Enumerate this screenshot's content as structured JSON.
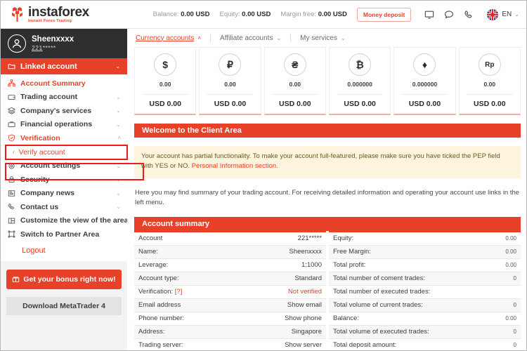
{
  "header": {
    "brand_name": "instaforex",
    "brand_tagline": "Instant Forex Trading",
    "stats": [
      {
        "label": "Balance:",
        "value": "0.00 USD"
      },
      {
        "label": "Equity:",
        "value": "0.00 USD"
      },
      {
        "label": "Margin free:",
        "value": "0.00 USD"
      }
    ],
    "deposit_button": "Money deposit",
    "icons": [
      "monitor-icon",
      "chat-icon",
      "phone-icon"
    ],
    "language": "EN",
    "language_caret": "⌄"
  },
  "sidebar": {
    "user": {
      "name": "Sheenxxxx",
      "id_prefix": "221",
      "id_mask": "*****"
    },
    "linked_account": {
      "label": "Linked account",
      "caret": "⌄"
    },
    "items": [
      {
        "label": "Account Summary",
        "icon": "dashboard-icon",
        "caret": "",
        "active": true
      },
      {
        "label": "Trading account",
        "icon": "wallet-icon",
        "caret": "⌄",
        "active": false
      },
      {
        "label": "Company's services",
        "icon": "layers-icon",
        "caret": "⌄",
        "active": false
      },
      {
        "label": "Financial operations",
        "icon": "briefcase-icon",
        "caret": "⌄",
        "active": false
      },
      {
        "label": "Verification",
        "icon": "shield-check-icon",
        "caret": "˄",
        "active": true
      },
      {
        "label": "Account settings",
        "icon": "gear-icon",
        "caret": "⌄",
        "active": false
      },
      {
        "label": "Security",
        "icon": "lock-icon",
        "caret": "⌄",
        "active": false
      },
      {
        "label": "Company news",
        "icon": "news-icon",
        "caret": "⌄",
        "active": false
      },
      {
        "label": "Contact us",
        "icon": "phone-icon",
        "caret": "⌄",
        "active": false
      },
      {
        "label": "Customize the view of the area",
        "icon": "layout-icon",
        "caret": "",
        "active": false
      },
      {
        "label": "Switch to Partner Area",
        "icon": "switch-icon",
        "caret": "",
        "active": false
      }
    ],
    "verify_sub_item": {
      "label": "Verify account",
      "arrow": "‹"
    },
    "logout": "Logout",
    "bonus_button": {
      "label": "Get your bonus right now!",
      "icon": "gift-icon"
    },
    "mt4_button": "Download MetaTrader 4"
  },
  "main": {
    "tabs": [
      {
        "label": "Currency accounts",
        "caret": "˄",
        "active": true
      },
      {
        "label": "Affiliate accounts",
        "caret": "⌄",
        "active": false
      },
      {
        "label": "My services",
        "caret": "⌄",
        "active": false
      }
    ],
    "cards": [
      {
        "symbol": "$",
        "currency": "usd-icon",
        "amount": "0.00",
        "usd": "USD 0.00",
        "small": false
      },
      {
        "symbol": "₽",
        "currency": "rub-icon",
        "amount": "0.00",
        "usd": "USD 0.00",
        "small": false
      },
      {
        "symbol": "₴",
        "currency": "uah-icon",
        "amount": "0.00",
        "usd": "USD 0.00",
        "small": false
      },
      {
        "symbol": "₿",
        "currency": "btc-icon",
        "amount": "0.000000",
        "usd": "USD 0.00",
        "small": false
      },
      {
        "symbol": "♦",
        "currency": "eth-icon",
        "amount": "0.000000",
        "usd": "USD 0.00",
        "small": false
      },
      {
        "symbol": "Rp",
        "currency": "idr-icon",
        "amount": "0.00",
        "usd": "USD 0.00",
        "small": true
      }
    ],
    "welcome_header": "Welcome to the Client Area",
    "warning": {
      "text_before": "Your account has partial functionality. To make your account full-featured, please make sure you have ticked the PEP field with YES or NO. ",
      "link": "Personal Information section."
    },
    "info_text": "Here you may find summary of your trading account. For receiving detailed information and operating your account use links in the left menu.",
    "summary_header": "Account summary",
    "summary_left": [
      {
        "key": "Account",
        "value": "221*****",
        "red": false
      },
      {
        "key": "Name:",
        "value": "Sheenxxxx",
        "red": false
      },
      {
        "key": "Leverage:",
        "value": "1:1000",
        "red": false
      },
      {
        "key": "Account type:",
        "value": "Standard",
        "red": false
      },
      {
        "key": "Verification:",
        "hint": "[?]",
        "value": "Not verified",
        "red": true
      },
      {
        "key": "Email address",
        "value": "Show email",
        "red": false
      },
      {
        "key": "Phone number:",
        "value": "Show phone",
        "red": false
      },
      {
        "key": "Address:",
        "value": "Singapore",
        "red": false
      },
      {
        "key": "Trading server:",
        "value": "Show server",
        "red": false
      }
    ],
    "summary_right": [
      {
        "key": "Equity:",
        "value": "0.00"
      },
      {
        "key": "Free Margin:",
        "value": "0.00"
      },
      {
        "key": "Total profit:",
        "value": "0.00"
      },
      {
        "key": "Total number of coment trades:",
        "value": "0"
      },
      {
        "key": "Total number of executed trades:",
        "value": ""
      },
      {
        "key": "Total volume of current trades:",
        "value": "0"
      },
      {
        "key": "Balance:",
        "value": "0.00"
      },
      {
        "key": "Total volume of executed trades:",
        "value": "0"
      },
      {
        "key": "Total deposit amount:",
        "value": "0"
      }
    ]
  },
  "colors": {
    "accent_red": "#e8412a",
    "annotation_red": "#ee1b1b",
    "warn_bg": "#fcf4dc",
    "dark_panel": "#2f2f2f"
  }
}
